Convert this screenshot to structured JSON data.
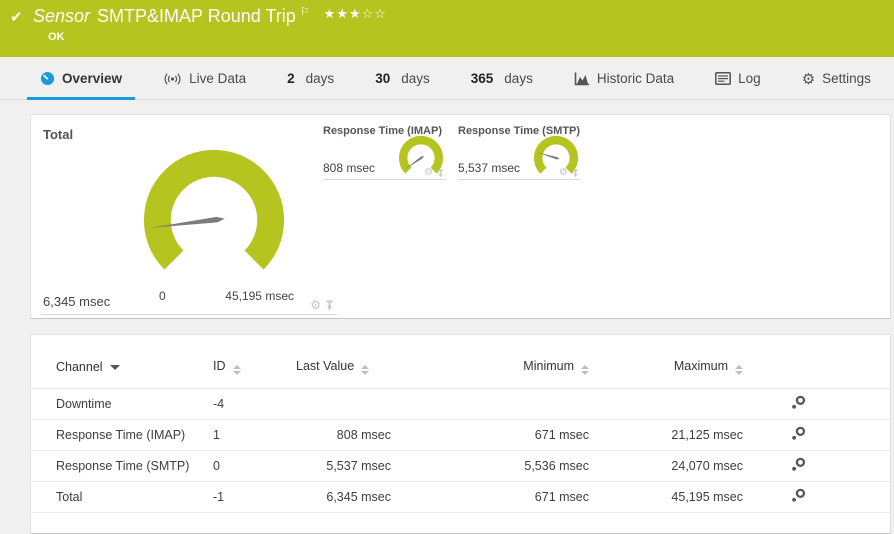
{
  "header": {
    "kind_label": "Sensor",
    "title": "SMTP&IMAP Round Trip",
    "status": "OK",
    "rating_filled": 3,
    "rating_total": 5,
    "colors": {
      "bar_ok_green": "#b5c41e",
      "accent_blue": "#1b9cd8"
    }
  },
  "icons": {
    "check": "✔",
    "flag": "⚐",
    "stars_filled": "★★★",
    "stars_empty": "☆☆",
    "gear": "⚙"
  },
  "tabs": {
    "overview": {
      "label": "Overview",
      "active": true
    },
    "live_data": {
      "label": "Live Data"
    },
    "d2": {
      "num": "2",
      "unit": "days"
    },
    "d30": {
      "num": "30",
      "unit": "days"
    },
    "d365": {
      "num": "365",
      "unit": "days"
    },
    "historic": {
      "label": "Historic Data"
    },
    "log": {
      "label": "Log"
    },
    "settings": {
      "label": "Settings"
    }
  },
  "gauges": {
    "total": {
      "label": "Total",
      "value": "6,345 msec",
      "value_msec": 6345,
      "scale_min": "0",
      "scale_max": "45,195 msec",
      "scale_max_msec": 45195,
      "needle_deg": -97
    },
    "imap": {
      "label": "Response Time (IMAP)",
      "value": "808 msec",
      "value_msec": 808,
      "needle_deg": -125
    },
    "smtp": {
      "label": "Response Time (SMTP)",
      "value": "5,537 msec",
      "value_msec": 5537,
      "needle_deg": -73
    }
  },
  "table": {
    "columns": {
      "channel": "Channel",
      "id": "ID",
      "last": "Last Value",
      "min": "Minimum",
      "max": "Maximum"
    },
    "rows": [
      {
        "channel": "Downtime",
        "id": "-4",
        "last": "",
        "min": "",
        "max": ""
      },
      {
        "channel": "Response Time (IMAP)",
        "id": "1",
        "last": "808 msec",
        "min": "671 msec",
        "max": "21,125 msec"
      },
      {
        "channel": "Response Time (SMTP)",
        "id": "0",
        "last": "5,537 msec",
        "min": "5,536 msec",
        "max": "24,070 msec"
      },
      {
        "channel": "Total",
        "id": "-1",
        "last": "6,345 msec",
        "min": "671 msec",
        "max": "45,195 msec"
      }
    ]
  }
}
